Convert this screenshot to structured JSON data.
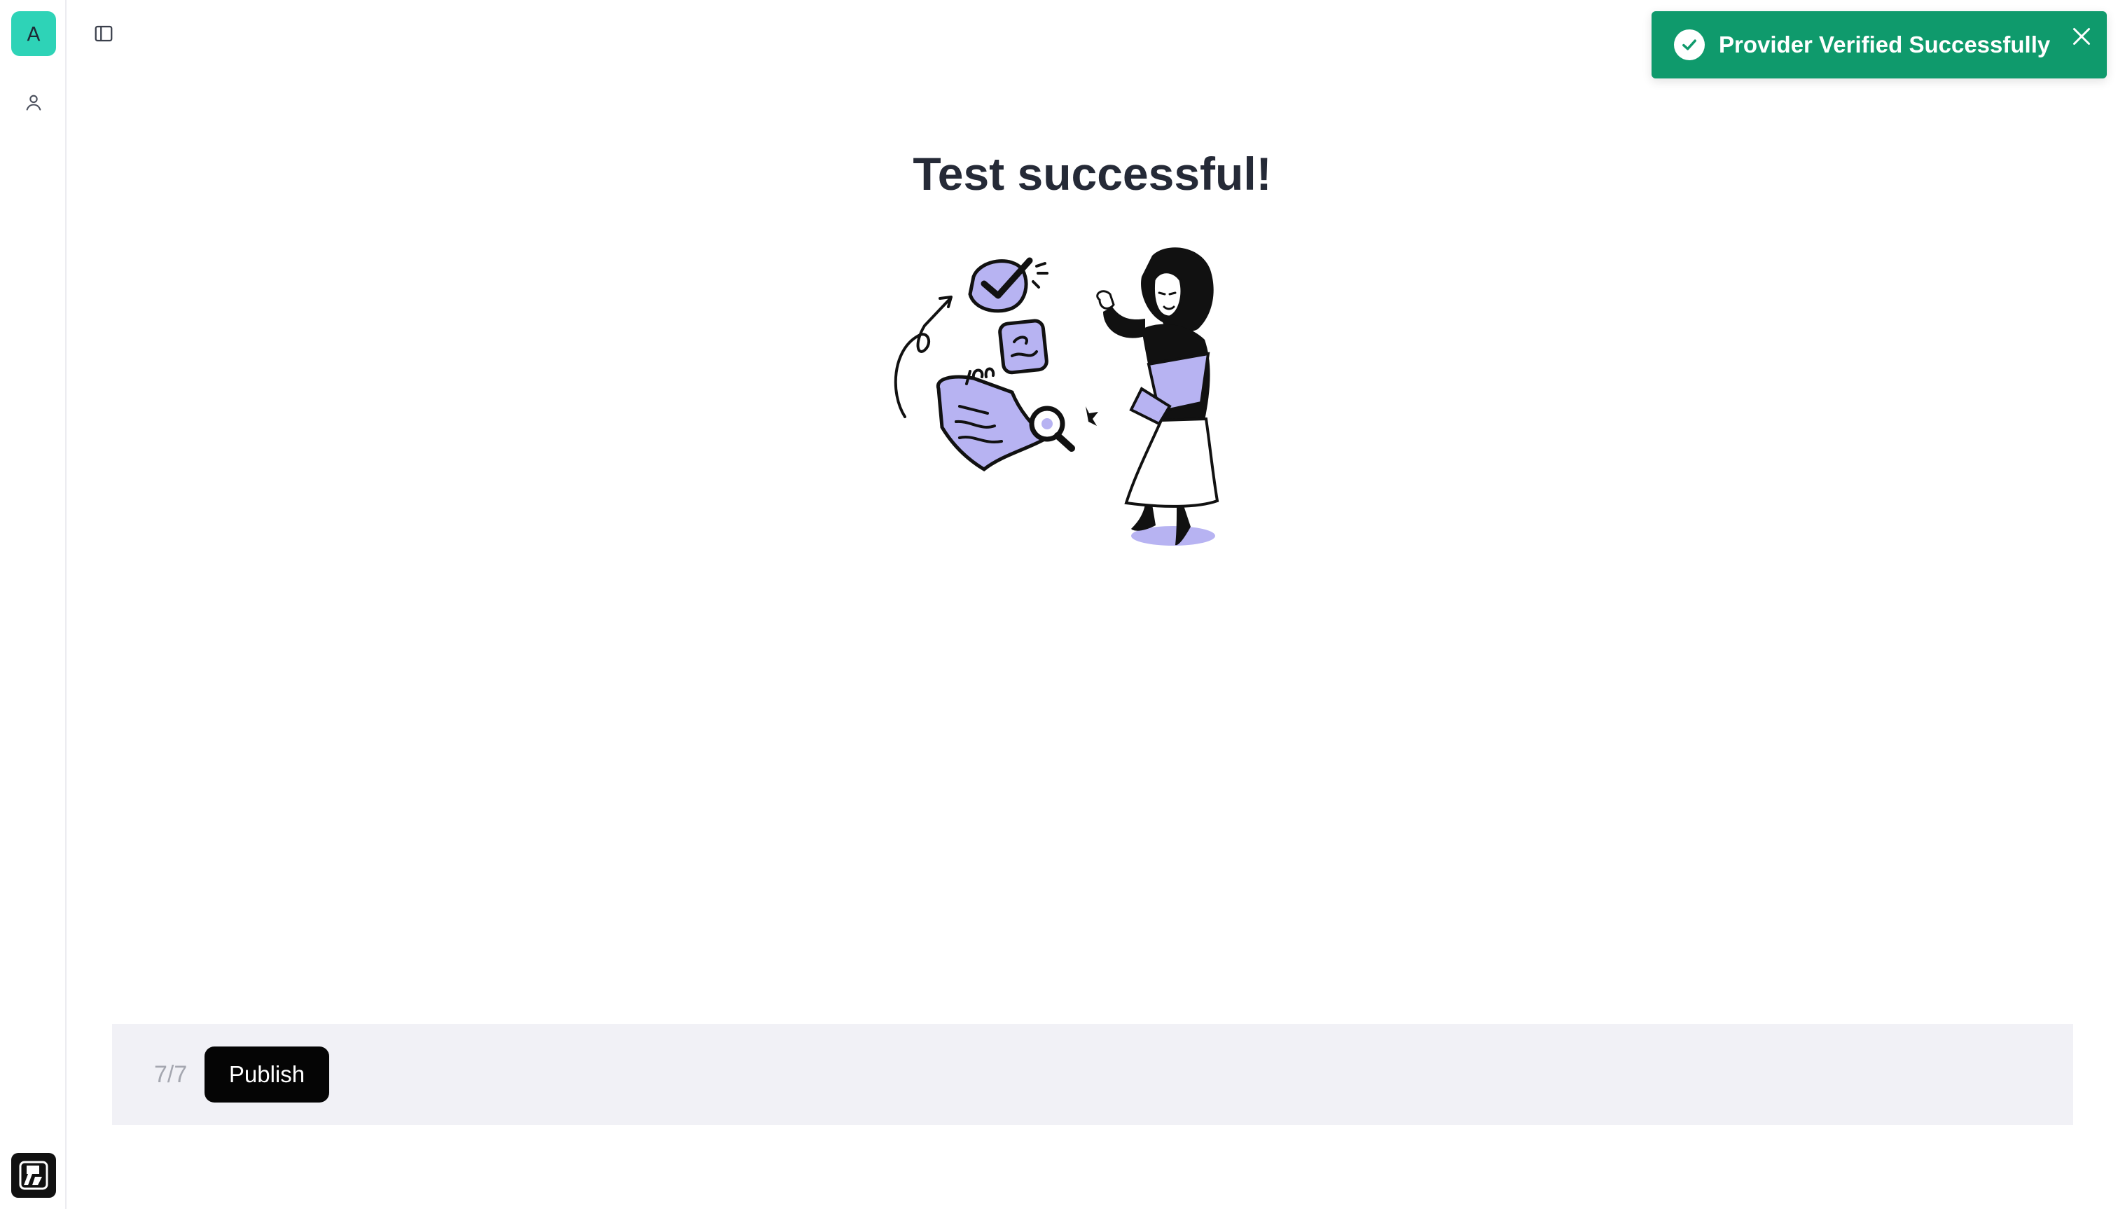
{
  "sidebar": {
    "avatar_initial": "A",
    "avatar_color": "#2ed3b7",
    "nav_icon": "user-icon",
    "logo_icon": "app-logo"
  },
  "header": {
    "toggle_icon": "sidebar-toggle-icon"
  },
  "toast": {
    "message": "Provider Verified Successfully",
    "status_icon": "check-circle-icon",
    "close_icon": "close-icon",
    "color": "#0f9a6c"
  },
  "main": {
    "title": "Test successful!",
    "illustration": "woman-with-checklist-illustration",
    "accent_color": "#b7b3f2"
  },
  "footer": {
    "step_counter": "7/7",
    "publish_label": "Publish"
  }
}
